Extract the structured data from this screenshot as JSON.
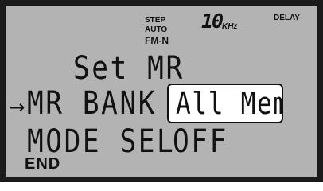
{
  "indicators": {
    "step": "STEP",
    "auto": "AUTO",
    "mode": "FM-N",
    "frequency_step": "10",
    "frequency_unit": "KHz",
    "delay": "DELAY"
  },
  "menu": {
    "title": "Set MR",
    "cursor": "→",
    "rows": [
      {
        "label": "MR BANK",
        "value": "All Mem",
        "selected": true
      },
      {
        "label": "MODE SEL",
        "value": "OFF",
        "selected": false
      }
    ]
  },
  "softkey": {
    "end_label": "END"
  },
  "colors": {
    "lcd_background": "#b3b3b3",
    "bezel": "#1b1b1b",
    "segment": "#111111",
    "highlight_background": "#ffffff"
  }
}
